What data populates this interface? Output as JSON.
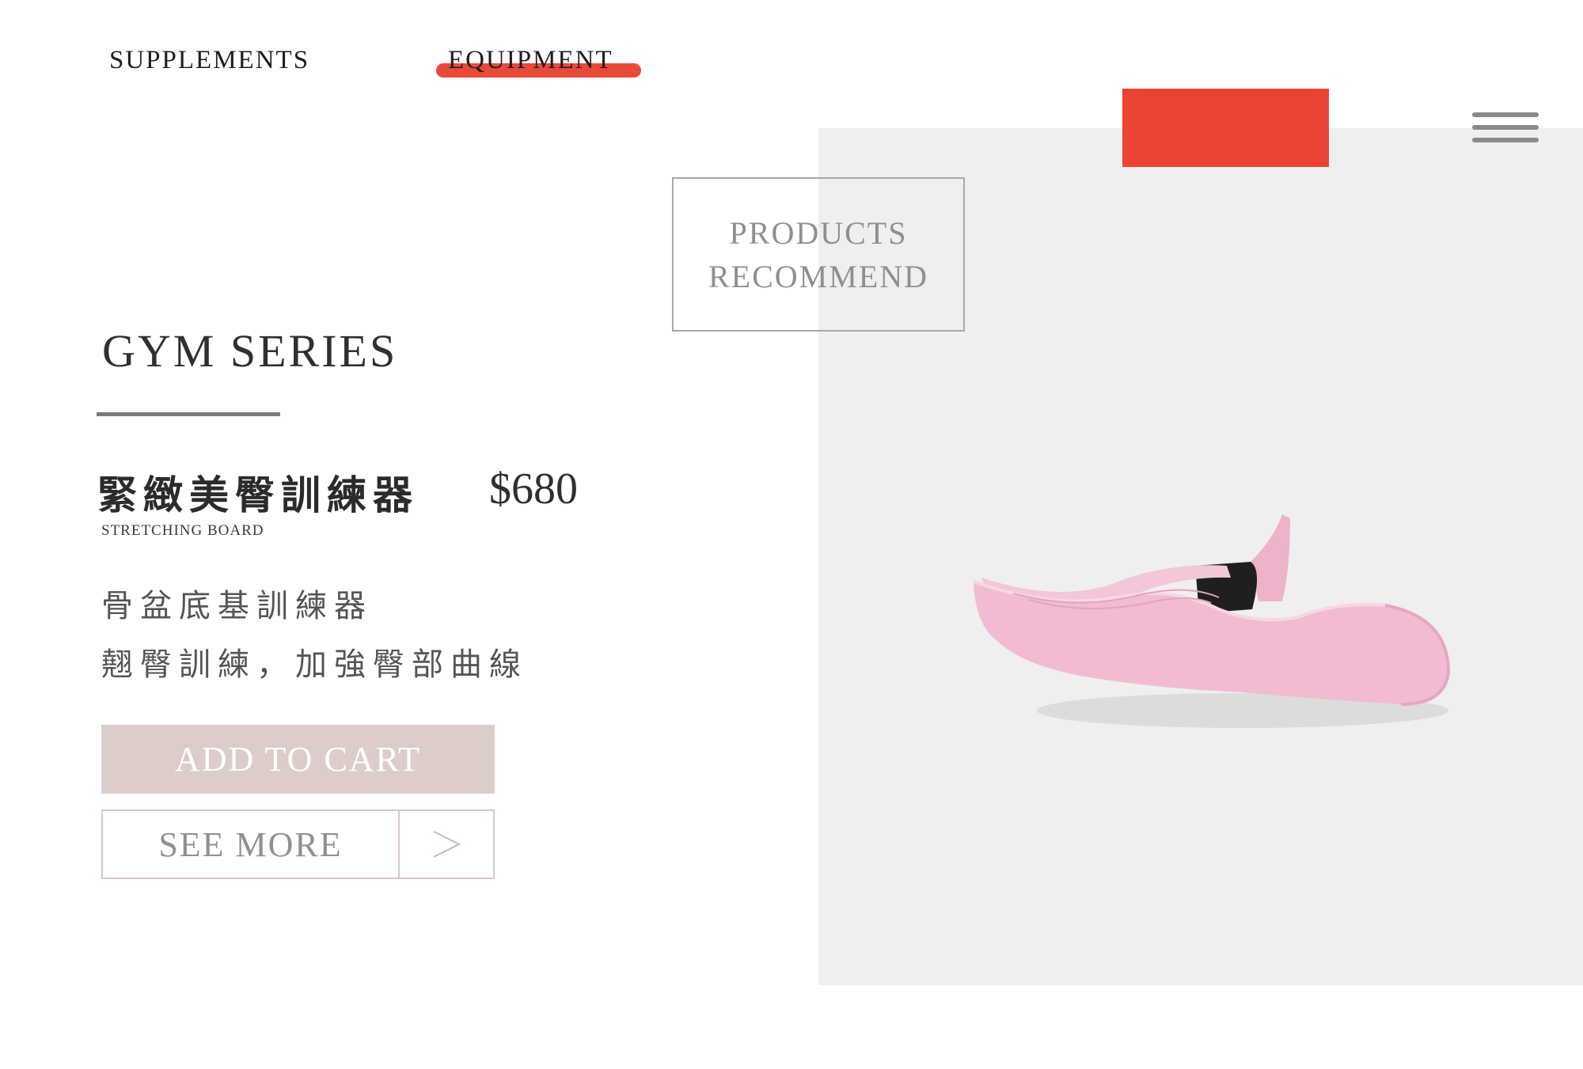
{
  "nav": {
    "items": [
      {
        "label": "SUPPLEMENTS",
        "active": false
      },
      {
        "label": "EQUIPMENT",
        "active": true
      }
    ],
    "accent_color": "#e84a3a"
  },
  "recommend": {
    "line1": "PRODUCTS",
    "line2": "RECOMMEND"
  },
  "series": {
    "title": "GYM SERIES"
  },
  "product": {
    "name": "緊緻美臀訓練器",
    "price": "$680",
    "subtitle": "STRETCHING BOARD",
    "description": [
      "骨盆底基訓練器",
      "翹臀訓練，加強臀部曲線"
    ],
    "image_icon": "pink-hip-trainer-image"
  },
  "actions": {
    "add_to_cart": "ADD TO CART",
    "see_more": "SEE MORE",
    "see_more_arrow_icon": "chevron-right-icon"
  },
  "colors": {
    "panel": "#efefef",
    "red_block": "#ec4434",
    "cart_button": "#dccdca",
    "product_pink": "#f1bcd3"
  }
}
